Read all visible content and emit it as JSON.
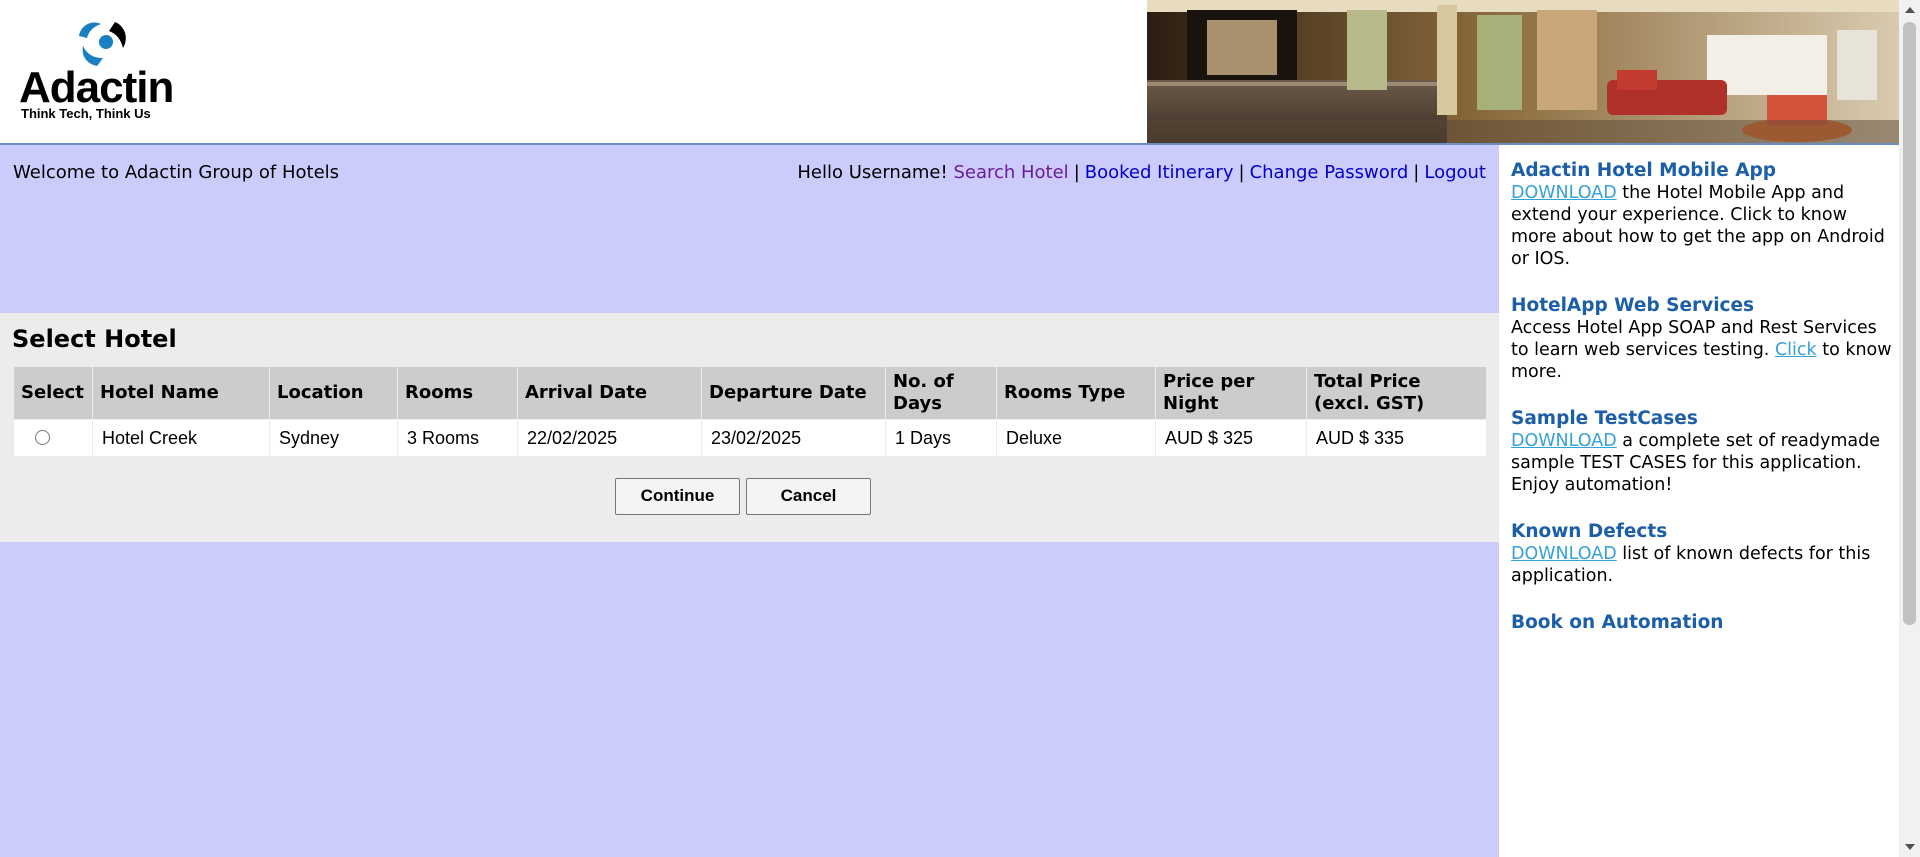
{
  "brand": {
    "name": "Adactin",
    "tagline": "Think Tech, Think Us"
  },
  "welcome": "Welcome to Adactin Group of Hotels",
  "nav": {
    "greeting": "Hello Username!",
    "separator": "|",
    "links": [
      "Search Hotel",
      "Booked Itinerary",
      "Change Password",
      "Logout"
    ]
  },
  "select_hotel": {
    "title": "Select Hotel",
    "columns": [
      "Select",
      "Hotel Name",
      "Location",
      "Rooms",
      "Arrival Date",
      "Departure Date",
      "No. of Days",
      "Rooms Type",
      "Price per Night",
      "Total Price (excl. GST)"
    ],
    "rows": [
      {
        "selected": false,
        "hotel_name": "Hotel Creek",
        "location": "Sydney",
        "rooms": "3 Rooms",
        "arrival_date": "22/02/2025",
        "departure_date": "23/02/2025",
        "days": "1 Days",
        "room_type": "Deluxe",
        "price_per_night": "AUD $ 325",
        "total_price": "AUD $ 335"
      }
    ],
    "buttons": {
      "continue": "Continue",
      "cancel": "Cancel"
    }
  },
  "sidebar": {
    "mobile_app": {
      "title": "Adactin Hotel Mobile App",
      "link": "DOWNLOAD",
      "text": " the Hotel Mobile App and extend your experience. Click to know more about how to get the app on Android or IOS."
    },
    "web_services": {
      "title": "HotelApp Web Services",
      "text_before": "Access Hotel App SOAP and Rest Services to learn web services testing. ",
      "link": "Click",
      "text_after": " to know more."
    },
    "test_cases": {
      "title": "Sample TestCases",
      "link": "DOWNLOAD",
      "text": " a complete set of readymade sample TEST CASES for this application. Enjoy automation!"
    },
    "known_defects": {
      "title": "Known Defects",
      "link": "DOWNLOAD",
      "text": " list of known defects for this application."
    },
    "book": {
      "title": "Book on Automation"
    }
  },
  "colors": {
    "main_background": "#ccccfc",
    "panel_background": "#ececec",
    "link": "#0000cc",
    "visited_link": "#6a1b9a",
    "sidebar_title": "#1c5fa8",
    "sidebar_link": "#35a1d9"
  }
}
